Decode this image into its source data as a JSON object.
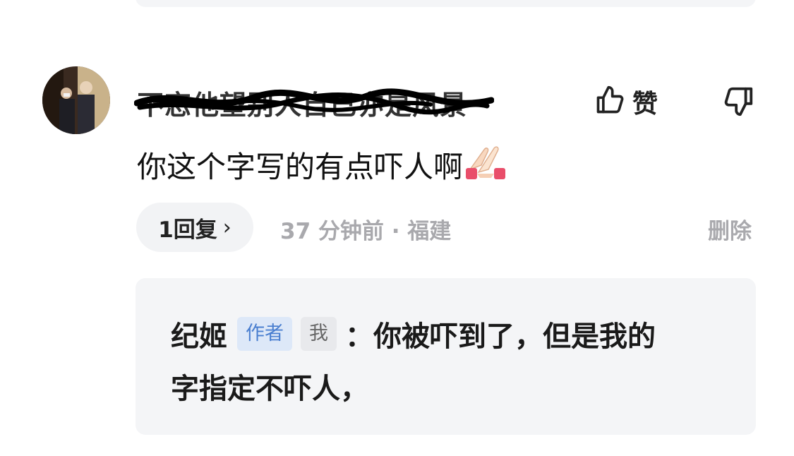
{
  "comment": {
    "username": "不恋他望别人自己亦是风景",
    "text": "你这个字写的有点吓人啊",
    "emoji": "🙏",
    "like_label": "赞",
    "reply_count_label": "1回复",
    "reply_chevron": "›",
    "meta": "37 分钟前 · 福建",
    "delete_label": "删除",
    "icons": {
      "like": "thumbs-up-icon",
      "dislike": "thumbs-down-icon",
      "emoji": "clapping-hands-emoji"
    }
  },
  "reply": {
    "author": "纪姬",
    "author_tag": "作者",
    "me_tag": "我",
    "text_line1": "：你被吓到了，但是我的",
    "text_line2": "字指定不吓人，"
  },
  "colors": {
    "background": "#ffffff",
    "card_background": "#f4f5f7",
    "meta_text": "#a9a9ad",
    "author_tag_bg": "#dde8f8",
    "author_tag_text": "#4a7fd0"
  }
}
